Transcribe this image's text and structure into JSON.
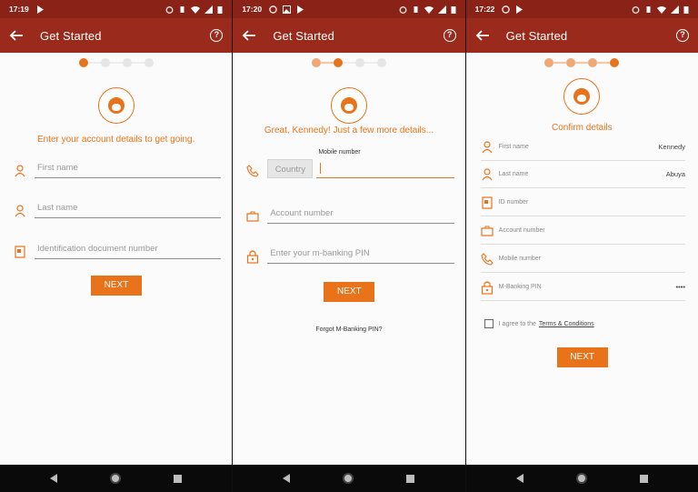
{
  "colors": {
    "statusbar": "#8b2218",
    "appbar": "#9a2a1c",
    "accent": "#e9731a",
    "background": "#fbfbfb"
  },
  "screens": [
    {
      "time": "17:19",
      "title": "Get Started",
      "headline": "Enter your account details to get going.",
      "fields": [
        {
          "icon": "person-icon",
          "placeholder": "First name"
        },
        {
          "icon": "person-icon",
          "placeholder": "Last name"
        },
        {
          "icon": "id-card-icon",
          "placeholder": "Identification document number"
        }
      ],
      "button": "NEXT"
    },
    {
      "time": "17:20",
      "title": "Get Started",
      "headline": "Great, Kennedy! Just a few more details...",
      "mobile_label": "Mobile number",
      "country_placeholder": "Country",
      "fields": [
        {
          "icon": "briefcase-icon",
          "placeholder": "Account number"
        },
        {
          "icon": "lock-icon",
          "placeholder": "Enter your m-banking PIN"
        }
      ],
      "button": "NEXT",
      "forgot": "Forgot M-Banking PIN?"
    },
    {
      "time": "17:22",
      "title": "Get Started",
      "headline": "Confirm details",
      "rows": [
        {
          "icon": "person-icon",
          "label": "First name",
          "value": "Kennedy"
        },
        {
          "icon": "person-icon",
          "label": "Last name",
          "value": "Abuya"
        },
        {
          "icon": "id-card-icon",
          "label": "ID number",
          "value": ""
        },
        {
          "icon": "briefcase-icon",
          "label": "Account number",
          "value": ""
        },
        {
          "icon": "phone-icon",
          "label": "Mobile number",
          "value": ""
        },
        {
          "icon": "lock-icon",
          "label": "M-Banking PIN",
          "value": "••••"
        }
      ],
      "agree_text": "I agree to the",
      "terms": "Terms & Conditions",
      "button": "NEXT"
    }
  ]
}
